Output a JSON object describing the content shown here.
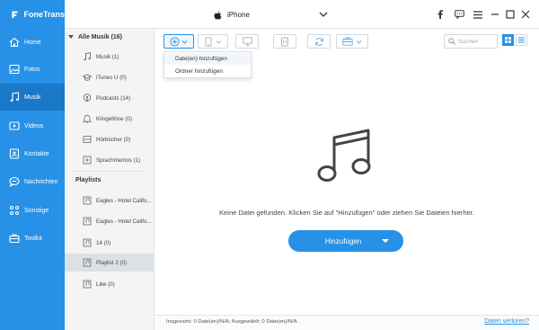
{
  "app": {
    "name": "FoneTrans",
    "accent": "#2691e6"
  },
  "device": {
    "name": "iPhone"
  },
  "titlebar_icons": [
    "apple-icon",
    "chevron-down-icon",
    "facebook-icon",
    "feedback-icon",
    "menu-icon",
    "minimize-icon",
    "maximize-icon",
    "close-icon"
  ],
  "sidebar": {
    "items": [
      {
        "label": "Home",
        "icon": "home-icon"
      },
      {
        "label": "Fotos",
        "icon": "photo-icon"
      },
      {
        "label": "Musik",
        "icon": "music-icon",
        "active": true
      },
      {
        "label": "Videos",
        "icon": "video-icon"
      },
      {
        "label": "Kontakte",
        "icon": "contacts-icon"
      },
      {
        "label": "Nachrichten",
        "icon": "messages-icon"
      },
      {
        "label": "Sonstige",
        "icon": "other-icon"
      },
      {
        "label": "Toolkit",
        "icon": "toolkit-icon"
      }
    ]
  },
  "categories": {
    "header": "Alle Musik (16)",
    "items": [
      {
        "label": "Musik (1)",
        "icon": "music-note-icon"
      },
      {
        "label": "iTunes U (0)",
        "icon": "graduation-cap-icon"
      },
      {
        "label": "Podcasts (14)",
        "icon": "podcast-icon"
      },
      {
        "label": "Klingeltöne (0)",
        "icon": "bell-icon"
      },
      {
        "label": "Hörbücher (0)",
        "icon": "audiobook-icon"
      },
      {
        "label": "Sprachmemos (1)",
        "icon": "voice-memo-icon"
      }
    ],
    "playlists_header": "Playlists",
    "playlists": [
      {
        "label": "Eagles - Hotel Califo..."
      },
      {
        "label": "Eagles - Hotel Califo..."
      },
      {
        "label": "14 (0)"
      },
      {
        "label": "Playlist 2 (0)",
        "active": true
      },
      {
        "label": "Like (0)"
      }
    ]
  },
  "toolbar": {
    "buttons": [
      "add-icon",
      "export-to-device-icon",
      "export-to-pc-icon",
      "delete-icon",
      "sync-icon",
      "toolbox-icon"
    ],
    "search_placeholder": "Suchen",
    "view_modes": [
      "grid-view-icon",
      "list-view-icon"
    ]
  },
  "add_menu": {
    "items": [
      "Date(en) hinzufügen",
      "Ordner hinzufügen"
    ]
  },
  "main": {
    "empty_message": "Keine Datei gefunden. Klicken Sie auf \"Hinzufügen\" oder ziehen Sie Dateien hierher.",
    "add_button_label": "Hinzufügen"
  },
  "statusbar": {
    "text": "Insgesamt: 0 Date(en)/N/A; Ausgewählt: 0 Date(en)/N/A",
    "link": "Daten verloren?"
  }
}
